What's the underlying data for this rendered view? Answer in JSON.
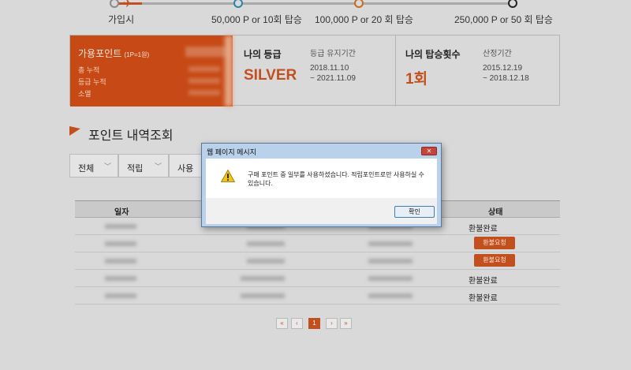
{
  "tiers": {
    "labels": [
      "가입시",
      "50,000 P or 10회 탑승",
      "100,000 P or 20 회 탑승",
      "250,000 P or 50 회 탑승"
    ]
  },
  "points": {
    "title": "가용포인트",
    "title_note": "(1P=1원)",
    "rows": [
      "총 누적",
      "등급 누적",
      "소멸"
    ]
  },
  "grade": {
    "label": "나의 등급",
    "value": "SILVER",
    "period_label": "등급 유지기간",
    "period_start": "2018.11.10",
    "period_end": "~ 2021.11.09"
  },
  "boarding": {
    "label": "나의 탑승횟수",
    "value": "1회",
    "period_label": "산정기간",
    "period_start": "2015.12.19",
    "period_end": "~ 2018.12.18"
  },
  "section": {
    "title": "포인트 내역조회"
  },
  "filters": [
    "전체",
    "적립",
    "사용"
  ],
  "table": {
    "headers": [
      "일자",
      "상태"
    ],
    "rows": [
      {
        "status": "환불완료",
        "button": false
      },
      {
        "status": "환불요청",
        "button": true
      },
      {
        "status": "환불요청",
        "button": true
      },
      {
        "status": "환불완료",
        "button": false
      },
      {
        "status": "환불완료",
        "button": false
      }
    ]
  },
  "pagination": {
    "first": "«",
    "prev": "‹",
    "current": "1",
    "next": "›",
    "last": "»"
  },
  "dialog": {
    "title": "웹 페이지 메시지",
    "close": "✕",
    "message": "구매 포인트 중 일부를 사용하셨습니다. 적립포인트로만 사용하실 수 있습니다.",
    "ok": "확인"
  }
}
